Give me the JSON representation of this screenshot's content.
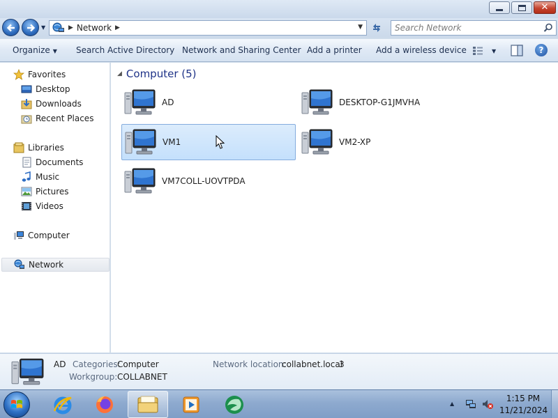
{
  "window": {
    "minimize_icon": "minimize-icon",
    "maximize_icon": "restore-icon",
    "close_icon": "close-icon"
  },
  "address": {
    "location": "Network",
    "search_placeholder": "Search Network"
  },
  "toolbar": {
    "organize": "Organize",
    "search_ad": "Search Active Directory",
    "network_sharing": "Network and Sharing Center",
    "add_printer": "Add a printer",
    "add_wireless": "Add a wireless device",
    "help": "?"
  },
  "sidebar": {
    "favorites": "Favorites",
    "favorites_items": [
      "Desktop",
      "Downloads",
      "Recent Places"
    ],
    "libraries": "Libraries",
    "libraries_items": [
      "Documents",
      "Music",
      "Pictures",
      "Videos"
    ],
    "computer": "Computer",
    "network": "Network"
  },
  "content": {
    "group_title": "Computer (5)",
    "computers": [
      "AD",
      "DESKTOP-G1JMVHA",
      "VM1",
      "VM2-XP",
      "VM7COLL-UOVTPDA"
    ],
    "selected": "VM1"
  },
  "details": {
    "name": "AD",
    "categories_label": "Categories:",
    "categories_value": "Computer",
    "workgroup_label": "Workgroup:",
    "workgroup_value": "COLLABNET",
    "location_label": "Network location:",
    "location_value": "collabnet.local",
    "location_extra": "3"
  },
  "taskbar": {
    "time": "1:15 PM",
    "date": "11/21/2024",
    "tray_arrow": "▲",
    "pinned": [
      "internet-explorer",
      "firefox",
      "windows-explorer",
      "media-player",
      "app-green"
    ]
  },
  "colors": {
    "accent": "#1e3287",
    "selection": "#c4e0fc",
    "taskbar": "#8eaacf"
  }
}
